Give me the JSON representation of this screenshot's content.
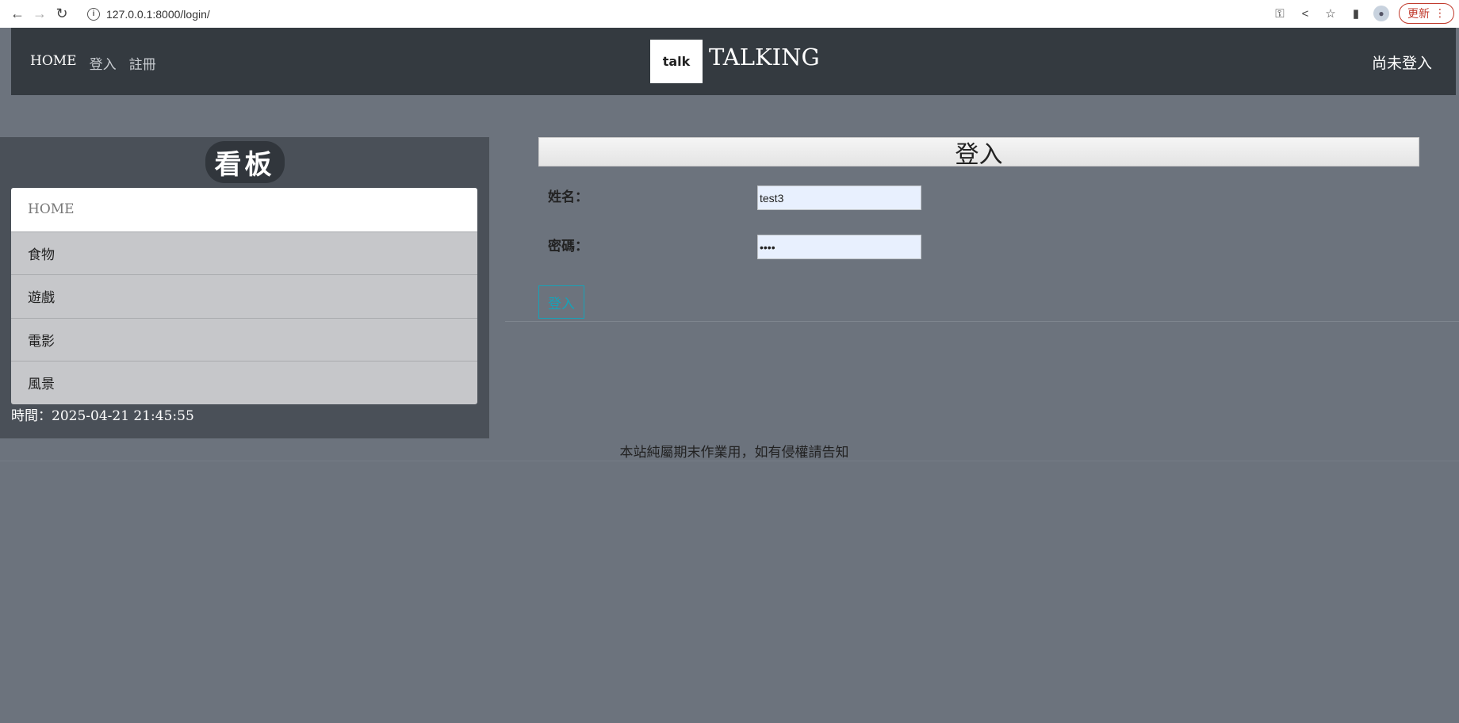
{
  "browser": {
    "url": "127.0.0.1:8000/login/",
    "update_label": "更新"
  },
  "header": {
    "nav": {
      "home": "HOME",
      "login": "登入",
      "register": "註冊"
    },
    "logo_text": "talk",
    "brand": "TALKING",
    "status": "尚未登入"
  },
  "sidebar": {
    "title": "看板",
    "items": [
      {
        "label": "HOME",
        "active": true
      },
      {
        "label": "食物"
      },
      {
        "label": "遊戲"
      },
      {
        "label": "電影"
      },
      {
        "label": "風景"
      }
    ],
    "time": "時間：2025-04-21 21:45:55"
  },
  "login_form": {
    "title": "登入",
    "name_label": "姓名：",
    "name_value": "test3",
    "password_label": "密碼：",
    "password_value": "••••",
    "submit_label": "登入"
  },
  "footer": {
    "text": "本站純屬期末作業用，如有侵權請告知"
  }
}
